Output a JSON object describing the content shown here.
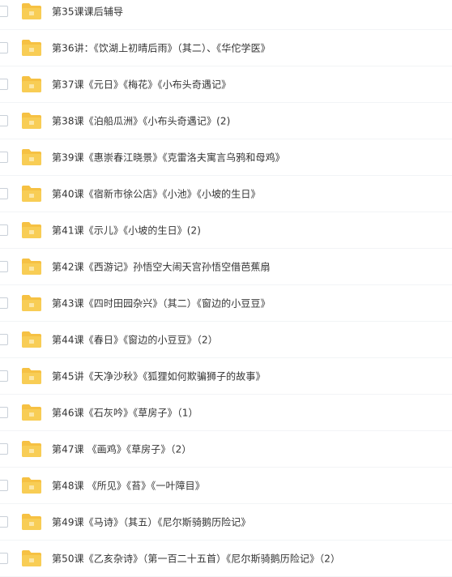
{
  "file_list": {
    "folder_color": "#f6c143",
    "items": [
      {
        "name": "第35课课后辅导"
      },
      {
        "name": "第36讲：《饮湖上初晴后雨》（其二）、《华佗学医》"
      },
      {
        "name": "第37课《元日》《梅花》《小布头奇遇记》"
      },
      {
        "name": "第38课《泊船瓜洲》《小布头奇遇记》(2)"
      },
      {
        "name": "第39课《惠崇春江晓景》《克雷洛夫寓言乌鸦和母鸡》"
      },
      {
        "name": "第40课《宿新市徐公店》《小池》《小坡的生日》"
      },
      {
        "name": "第41课《示儿》《小坡的生日》(2)"
      },
      {
        "name": "第42课《西游记》孙悟空大闹天宫孙悟空借芭蕉扇"
      },
      {
        "name": "第43课《四时田园杂兴》（其二）《窗边的小豆豆》"
      },
      {
        "name": "第44课《春日》《窗边的小豆豆》（2）"
      },
      {
        "name": "第45讲《天净沙秋》《狐狸如何欺骗狮子的故事》"
      },
      {
        "name": "第46课《石灰吟》《草房子》（1）"
      },
      {
        "name": "第47课 《画鸡》《草房子》（2）"
      },
      {
        "name": "第48课 《所见》《苔》《一叶障目》"
      },
      {
        "name": "第49课《马诗》（其五）《尼尔斯骑鹅历险记》"
      },
      {
        "name": "第50课《乙亥杂诗》（第一百二十五首）《尼尔斯骑鹅历险记》（2）"
      }
    ]
  }
}
